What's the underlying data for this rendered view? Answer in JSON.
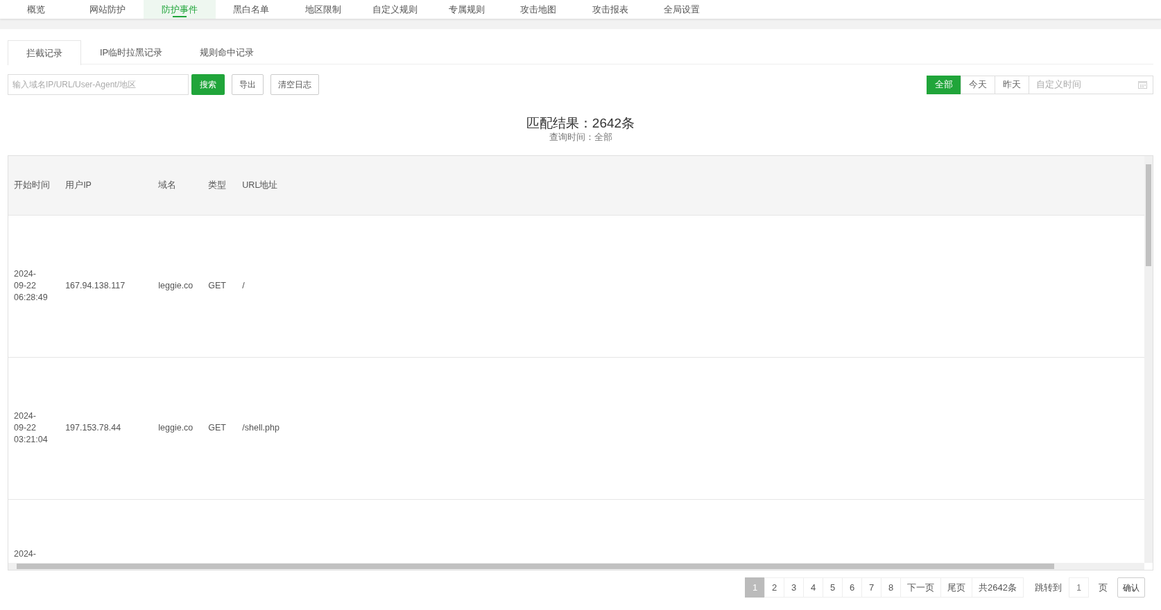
{
  "top_nav": [
    {
      "label": "概览",
      "selected": false
    },
    {
      "label": "网站防护",
      "selected": false
    },
    {
      "label": "防护事件",
      "selected": true
    },
    {
      "label": "黑白名单",
      "selected": false
    },
    {
      "label": "地区限制",
      "selected": false
    },
    {
      "label": "自定义规则",
      "selected": false
    },
    {
      "label": "专属规则",
      "selected": false
    },
    {
      "label": "攻击地图",
      "selected": false
    },
    {
      "label": "攻击报表",
      "selected": false
    },
    {
      "label": "全局设置",
      "selected": false
    }
  ],
  "tabs": [
    {
      "label": "拦截记录",
      "selected": true
    },
    {
      "label": "IP临时拉黑记录",
      "selected": false
    },
    {
      "label": "规则命中记录",
      "selected": false
    }
  ],
  "search": {
    "placeholder": "输入域名IP/URL/User-Agent/地区",
    "button": "搜索"
  },
  "actions": [
    "导出",
    "清空日志"
  ],
  "date_filter": {
    "options": [
      {
        "label": "全部",
        "selected": true
      },
      {
        "label": "今天",
        "selected": false
      },
      {
        "label": "昨天",
        "selected": false
      }
    ],
    "custom_placeholder": "自定义时间"
  },
  "result": {
    "title": "匹配结果：2642条",
    "subtitle": "查询时间：全部"
  },
  "table": {
    "columns": [
      "开始时间",
      "用户IP",
      "域名",
      "类型",
      "URL地址"
    ],
    "rows": [
      {
        "cells": [
          "2024-09-22 06:28:49",
          "167.94.138.117",
          "leggie.co",
          "GET",
          "/"
        ]
      },
      {
        "cells": [
          "2024-09-22 03:21:04",
          "197.153.78.44",
          "leggie.co",
          "GET",
          "/shell.php"
        ]
      },
      {
        "cells": [
          "2024-"
        ]
      }
    ]
  },
  "pagination": {
    "pages": [
      {
        "label": "1",
        "selected": true
      },
      {
        "label": "2",
        "selected": false
      },
      {
        "label": "3",
        "selected": false
      },
      {
        "label": "4",
        "selected": false
      },
      {
        "label": "5",
        "selected": false
      },
      {
        "label": "6",
        "selected": false
      },
      {
        "label": "7",
        "selected": false
      },
      {
        "label": "8",
        "selected": false
      }
    ],
    "next": "下一页",
    "last": "尾页",
    "total": "共2642条",
    "jump_label": "跳转到",
    "jump_value": "1",
    "page_unit": "页",
    "confirm": "确认"
  }
}
